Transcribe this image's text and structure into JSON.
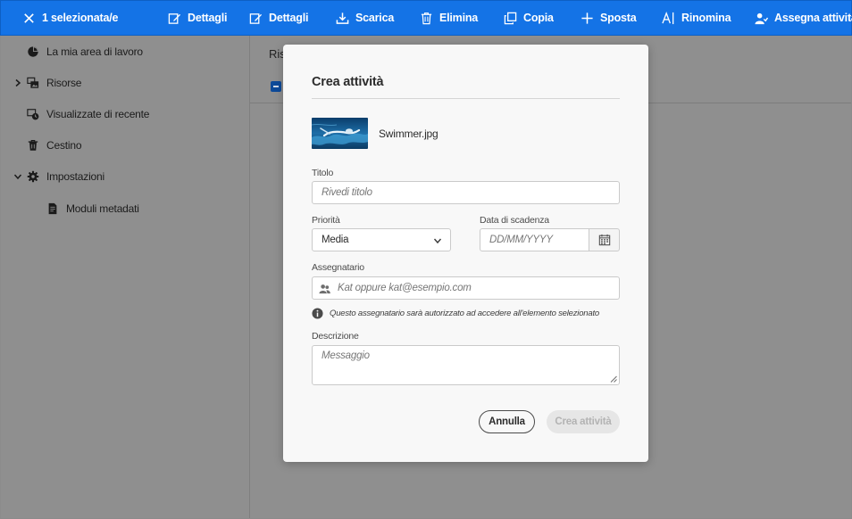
{
  "actionbar": {
    "selection_label": "1 selezionata/e",
    "details_label_1": "Dettagli",
    "details_label_2": "Dettagli",
    "download_label": "Scarica",
    "delete_label": "Elimina",
    "copy_label": "Copia",
    "move_label": "Sposta",
    "rename_label": "Rinomina",
    "assign_label": "Assegna attività",
    "color": "#1473e6"
  },
  "sidebar": {
    "items": [
      {
        "label": "La mia area di lavoro",
        "icon": "pie-chart-icon"
      },
      {
        "label": "Risorse",
        "icon": "assets-icon",
        "expandable": true,
        "expanded": false
      },
      {
        "label": "Visualizzate di recente",
        "icon": "recent-icon"
      },
      {
        "label": "Cestino",
        "icon": "trash-icon"
      },
      {
        "label": "Impostazioni",
        "icon": "gear-icon",
        "expandable": true,
        "expanded": true
      },
      {
        "label": "Moduli metadati",
        "icon": "document-icon"
      }
    ]
  },
  "main": {
    "breadcrumb": "Riso"
  },
  "dialog": {
    "title": "Crea attività",
    "file_name": "Swimmer.jpg",
    "titolo_label": "Titolo",
    "titolo_placeholder": "Rivedi titolo",
    "priority_label": "Priorità",
    "priority_value": "Media",
    "due_date_label": "Data di scadenza",
    "due_date_placeholder": "DD/MM/YYYY",
    "assignee_label": "Assegnatario",
    "assignee_placeholder": "Kat oppure kat@esempio.com",
    "assignee_info": "Questo assegnatario sarà autorizzato ad accedere all'elemento selezionato",
    "description_label": "Descrizione",
    "description_placeholder": "Messaggio",
    "cancel_label": "Annulla",
    "create_label": "Crea attività"
  }
}
